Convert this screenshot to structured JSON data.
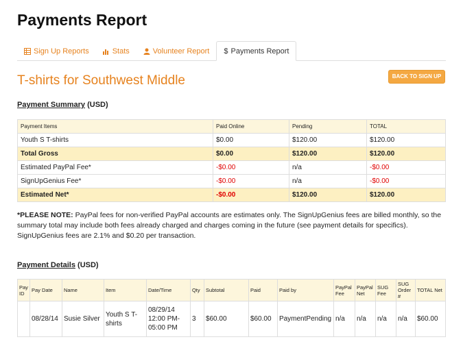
{
  "page_title": "Payments Report",
  "tabs": [
    {
      "label": "Sign Up Reports",
      "icon": "sheet-icon"
    },
    {
      "label": "Stats",
      "icon": "bar-chart-icon"
    },
    {
      "label": "Volunteer Report",
      "icon": "person-icon"
    },
    {
      "label": "Payments Report",
      "icon": "dollar-icon",
      "active": true
    }
  ],
  "section_title": "T-shirts for Southwest Middle",
  "back_button": "BACK TO SIGN UP",
  "summary": {
    "heading": "Payment Summary",
    "currency": "(USD)",
    "headers": [
      "Payment Items",
      "Paid Online",
      "Pending",
      "TOTAL"
    ],
    "rows": [
      {
        "item": "Youth S T-shirts",
        "paid": "$0.00",
        "pending": "$120.00",
        "total": "$120.00"
      },
      {
        "item": "Total Gross",
        "paid": "$0.00",
        "pending": "$120.00",
        "total": "$120.00"
      },
      {
        "item": "Estimated PayPal Fee*",
        "paid": "-$0.00",
        "pending": "n/a",
        "total": "-$0.00"
      },
      {
        "item": "SignUpGenius Fee*",
        "paid": "-$0.00",
        "pending": "n/a",
        "total": "-$0.00"
      },
      {
        "item": "Estimated Net*",
        "paid": "-$0.00",
        "pending": "$120.00",
        "total": "$120.00"
      }
    ]
  },
  "note": {
    "bold": "*PLEASE NOTE:",
    "text": " PayPal fees for non-verified PayPal accounts are estimates only. The SignUpGenius fees are billed monthly, so the summary total may include both fees already charged and charges coming in the future (see payment details for specifics). SignUpGenius fees are 2.1% and $0.20 per transaction."
  },
  "details": {
    "heading": "Payment Details",
    "currency": "(USD)",
    "headers": [
      "Pay ID",
      "Pay Date",
      "Name",
      "Item",
      "Date/Time",
      "Qty",
      "Subtotal",
      "Paid",
      "Paid by",
      "PayPal Fee",
      "PayPal Net",
      "SUG Fee",
      "SUG Order #",
      "TOTAL Net"
    ],
    "rows": [
      [
        "",
        "08/28/14",
        "Susie Silver",
        "Youth S T-shirts",
        "08/29/14 12:00 PM-05:00 PM",
        "3",
        "$60.00",
        "$60.00",
        "PaymentPending",
        "n/a",
        "n/a",
        "n/a",
        "n/a",
        "$60.00"
      ]
    ]
  },
  "colors": {
    "accent": "#e6821e",
    "button": "#f4a842",
    "highlight": "#fdf0c2",
    "negative": "#e00000"
  }
}
